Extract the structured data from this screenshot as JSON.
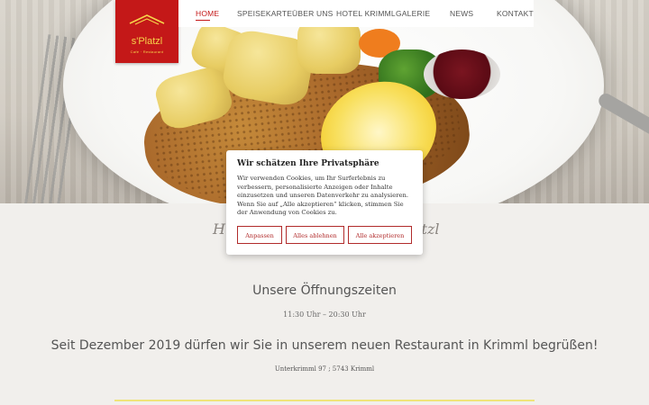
{
  "brand": {
    "name": "s'Platzl",
    "tagline": "Café · Restaurant",
    "color": "#c41818",
    "accent": "#f6d44a"
  },
  "nav": {
    "items": [
      {
        "label": "HOME",
        "active": true
      },
      {
        "label": "SPEISEKARTE"
      },
      {
        "label": "ÜBER UNS"
      },
      {
        "label": "HOTEL KRIMML"
      },
      {
        "label": "GALERIE"
      },
      {
        "label": "NEWS"
      },
      {
        "label": "KONTAKT"
      }
    ]
  },
  "content": {
    "heading_left": "H",
    "heading_right": "atzl",
    "hours_title": "Unsere Öffnungszeiten",
    "hours": "11:30 Uhr – 20:30 Uhr",
    "welcome": "Seit Dezember 2019 dürfen wir Sie in unserem neuen Restaurant in Krimml begrüßen!",
    "address": "Unterkrimml 97 ; 5743 Krimml"
  },
  "cookie": {
    "title": "Wir schätzen Ihre Privatsphäre",
    "text": "Wir verwenden Cookies, um Ihr Surferlebnis zu verbessern, personalisierte Anzeigen oder Inhalte einzusetzen und unseren Datenverkehr zu analysieren. Wenn Sie auf „Alle akzeptieren“ klicken, stimmen Sie der Anwendung von Cookies zu.",
    "buttons": {
      "customize": "Anpassen",
      "reject": "Alles ablehnen",
      "accept": "Alle akzeptieren"
    }
  }
}
